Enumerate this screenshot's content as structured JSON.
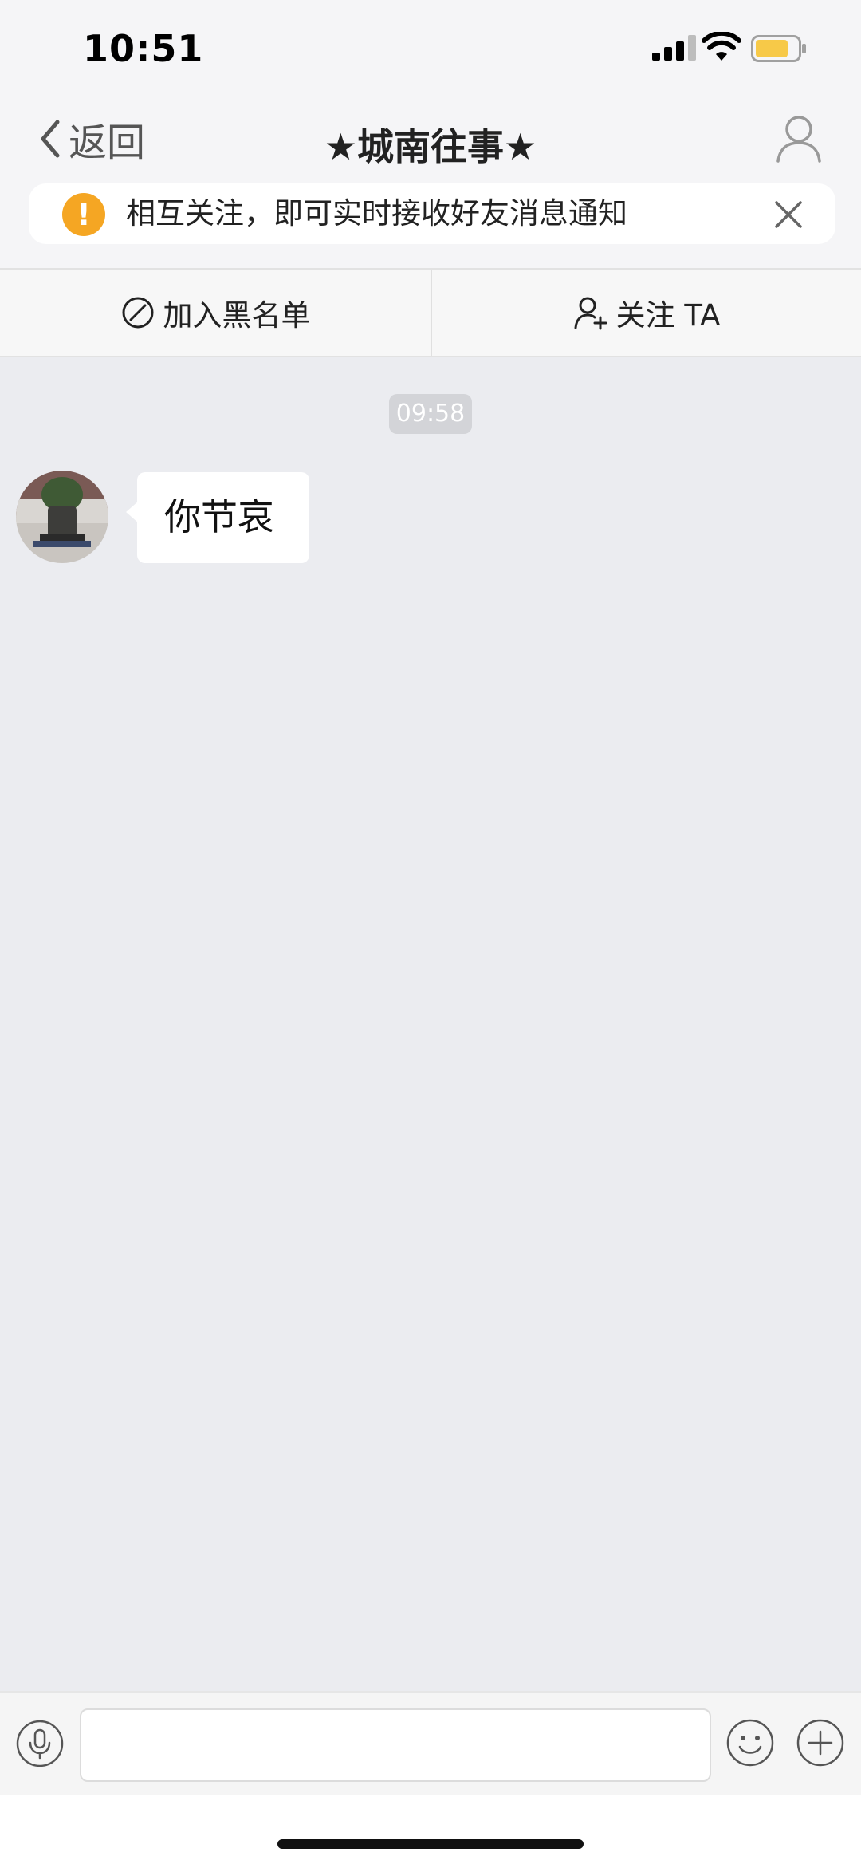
{
  "status_bar": {
    "time": "10:51"
  },
  "nav": {
    "back_label": "返回",
    "title": "★城南往事★"
  },
  "notice": {
    "icon_text": "!",
    "text": "相互关注，即可实时接收好友消息通知",
    "icon_color": "#f5a623"
  },
  "actions": {
    "blacklist_label": "加入黑名单",
    "follow_label": "关注 TA"
  },
  "chat": {
    "timestamp": "09:58",
    "messages": [
      {
        "sender": "other",
        "text": "你节哀"
      }
    ]
  },
  "input": {
    "value": "",
    "placeholder": ""
  },
  "icons": {
    "back": "chevron-left-icon",
    "profile": "person-icon",
    "close": "close-icon",
    "blacklist": "block-icon",
    "follow": "add-user-icon",
    "voice": "microphone-icon",
    "emoji": "smiley-icon",
    "more": "plus-icon"
  },
  "colors": {
    "background": "#ebecf0",
    "header": "#f5f5f7",
    "battery_fill": "#f7c948",
    "warning": "#f5a623"
  }
}
